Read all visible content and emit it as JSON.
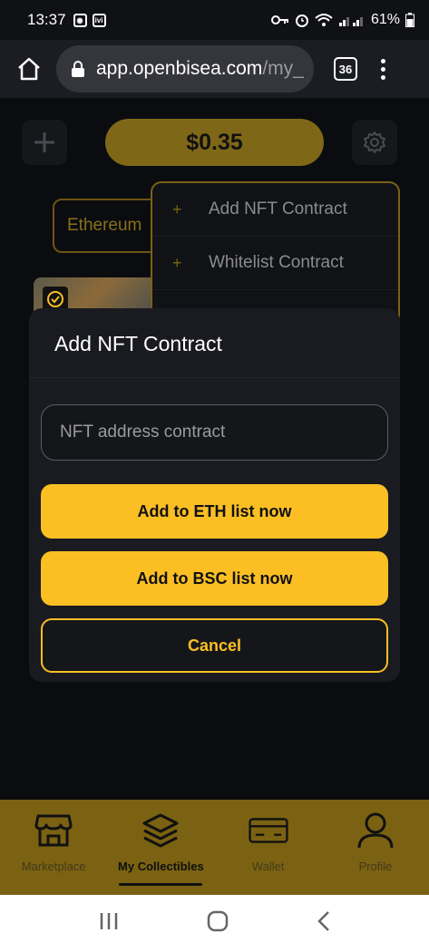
{
  "status_bar": {
    "time": "13:37",
    "ivi_badge": "ivi",
    "battery": "61%"
  },
  "browser": {
    "url_domain": "app.openbisea.com",
    "url_path": "/my_",
    "tab_count": "36"
  },
  "header": {
    "balance": "$0.35"
  },
  "chain_select": {
    "value": "Ethereum"
  },
  "dropdown": {
    "items": [
      {
        "plus": "+",
        "label": "Add NFT Contract"
      },
      {
        "plus": "+",
        "label": "Whitelist Contract"
      }
    ]
  },
  "modal": {
    "title": "Add NFT Contract",
    "input_placeholder": "NFT address contract",
    "input_value": "",
    "eth_button": "Add to ETH list now",
    "bsc_button": "Add to BSC list now",
    "cancel_button": "Cancel"
  },
  "bottom_nav": {
    "items": [
      {
        "label": "Marketplace",
        "icon": "store-icon"
      },
      {
        "label": "My Collectibles",
        "icon": "layers-icon",
        "active": true
      },
      {
        "label": "Wallet",
        "icon": "wallet-icon"
      },
      {
        "label": "Profile",
        "icon": "profile-icon"
      }
    ]
  },
  "colors": {
    "accent": "#fbbf24",
    "accent_dim": "#7a6212",
    "modal_bg": "#1a1b20",
    "app_bg": "#0b0c0f"
  }
}
